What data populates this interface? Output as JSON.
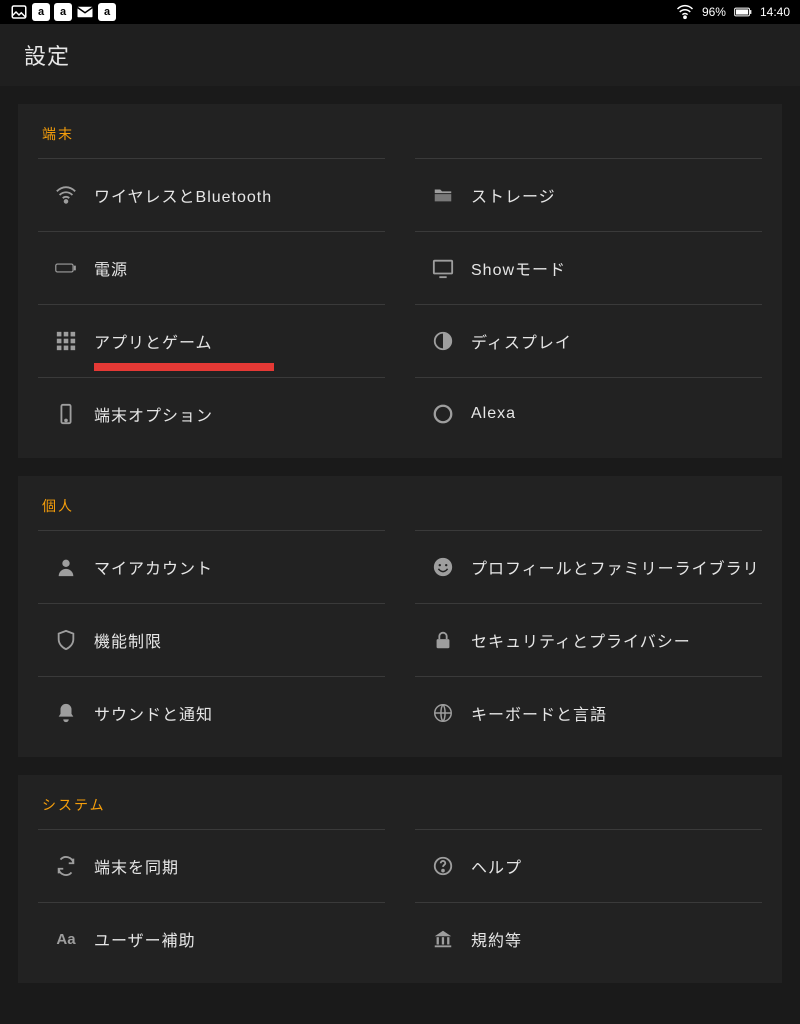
{
  "statusbar": {
    "badges": [
      "a",
      "a",
      "a"
    ],
    "battery_pct": "96%",
    "time": "14:40"
  },
  "header": {
    "title": "設定"
  },
  "accent": "#f59e0b",
  "highlight": "#e53935",
  "sections": {
    "device": {
      "title": "端末",
      "items_left": [
        {
          "icon": "wifi",
          "label": "ワイヤレスとBluetooth"
        },
        {
          "icon": "battery",
          "label": "電源"
        },
        {
          "icon": "apps",
          "label": "アプリとゲーム",
          "highlighted": true
        },
        {
          "icon": "device",
          "label": "端末オプション"
        }
      ],
      "items_right": [
        {
          "icon": "folder",
          "label": "ストレージ"
        },
        {
          "icon": "monitor",
          "label": "Showモード"
        },
        {
          "icon": "contrast",
          "label": "ディスプレイ"
        },
        {
          "icon": "alexa",
          "label": "Alexa"
        }
      ]
    },
    "personal": {
      "title": "個人",
      "items_left": [
        {
          "icon": "person",
          "label": "マイアカウント"
        },
        {
          "icon": "shield",
          "label": "機能制限"
        },
        {
          "icon": "bell",
          "label": "サウンドと通知"
        }
      ],
      "items_right": [
        {
          "icon": "smile",
          "label": "プロフィールとファミリーライブラリ"
        },
        {
          "icon": "lock",
          "label": "セキュリティとプライバシー"
        },
        {
          "icon": "globe",
          "label": "キーボードと言語"
        }
      ]
    },
    "system": {
      "title": "システム",
      "items_left": [
        {
          "icon": "sync",
          "label": "端末を同期"
        },
        {
          "icon": "aa",
          "label": "ユーザー補助"
        }
      ],
      "items_right": [
        {
          "icon": "help",
          "label": "ヘルプ"
        },
        {
          "icon": "legal",
          "label": "規約等"
        }
      ]
    }
  }
}
